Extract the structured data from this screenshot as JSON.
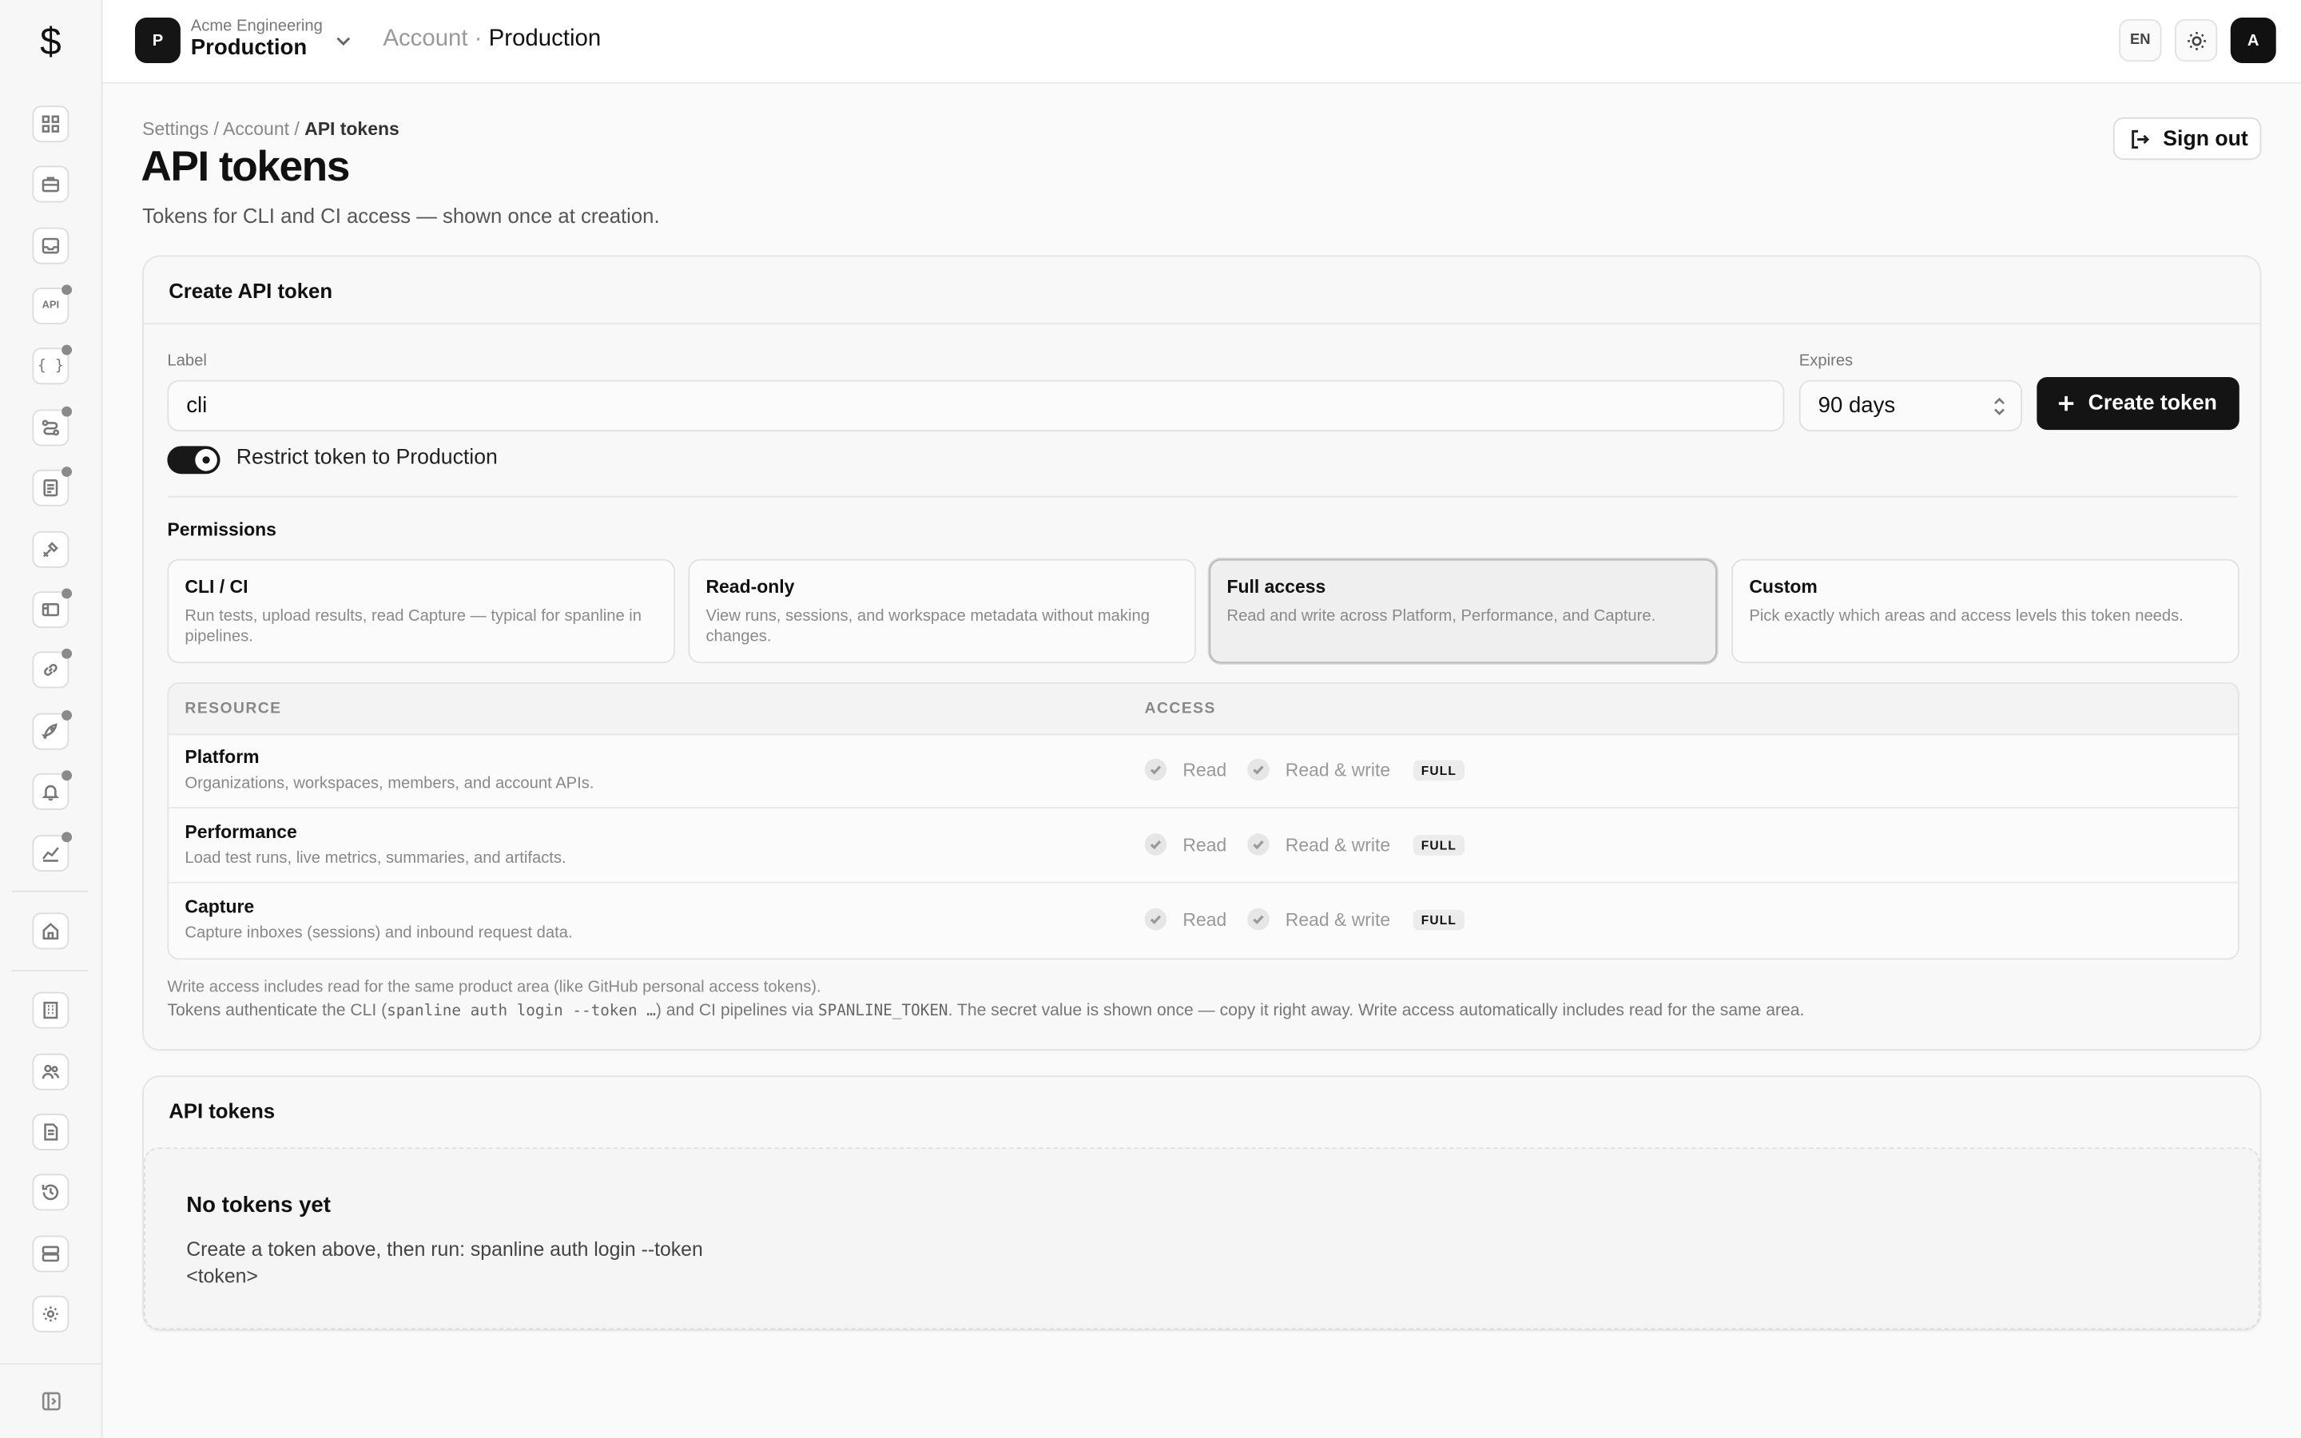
{
  "app": {
    "logo_glyph": "$"
  },
  "topbar": {
    "org_initial": "P",
    "org_name": "Acme Engineering",
    "org_env": "Production",
    "crumb_parent": "Account",
    "crumb_sep": " · ",
    "crumb_current": "Production",
    "lang": "EN",
    "user_initial": "A"
  },
  "sidebar": {
    "items": [
      {
        "icon": "dashboard-icon",
        "badge": false
      },
      {
        "icon": "briefcase-icon",
        "badge": false
      },
      {
        "icon": "inbox-icon",
        "badge": false
      },
      {
        "icon": "api-icon",
        "badge": true,
        "text": "API"
      },
      {
        "icon": "braces-icon",
        "badge": true,
        "text": "{ }"
      },
      {
        "icon": "workflow-icon",
        "badge": true
      },
      {
        "icon": "report-icon",
        "badge": true
      },
      {
        "icon": "tools-icon",
        "badge": false
      },
      {
        "icon": "ticket-icon",
        "badge": true
      },
      {
        "icon": "link-icon",
        "badge": true
      },
      {
        "icon": "rocket-icon",
        "badge": true
      },
      {
        "icon": "bell-icon",
        "badge": true
      },
      {
        "icon": "chart-icon",
        "badge": true
      },
      {
        "icon": "home-icon",
        "badge": false
      },
      {
        "icon": "building-icon",
        "badge": false
      },
      {
        "icon": "users-icon",
        "badge": false
      },
      {
        "icon": "document-icon",
        "badge": false
      },
      {
        "icon": "history-icon",
        "badge": false
      },
      {
        "icon": "storage-icon",
        "badge": false
      },
      {
        "icon": "settings-icon",
        "badge": false
      }
    ]
  },
  "header": {
    "breadcrumb": {
      "a": "Settings",
      "b": "Account",
      "c": "API tokens",
      "sep": " / "
    },
    "title": "API tokens",
    "subtitle": "Tokens for CLI and CI access — shown once at creation.",
    "sign_out": "Sign out"
  },
  "create": {
    "title": "Create API token",
    "label_label": "Label",
    "label_value": "cli",
    "expires_label": "Expires",
    "expires_value": "90 days",
    "create_button": "Create token",
    "restrict_label": "Restrict token to Production",
    "restrict_on": true,
    "permissions_title": "Permissions",
    "presets": [
      {
        "title": "CLI / CI",
        "desc": "Run tests, upload results, read Capture — typical for spanline in pipelines.",
        "selected": false
      },
      {
        "title": "Read-only",
        "desc": "View runs, sessions, and workspace metadata without making changes.",
        "selected": false
      },
      {
        "title": "Full access",
        "desc": "Read and write across Platform, Performance, and Capture.",
        "selected": true
      },
      {
        "title": "Custom",
        "desc": "Pick exactly which areas and access levels this token needs.",
        "selected": false
      }
    ],
    "table": {
      "col_resource": "RESOURCE",
      "col_access": "ACCESS",
      "rows": [
        {
          "name": "Platform",
          "desc": "Organizations, workspaces, members, and account APIs.",
          "read": "Read",
          "write": "Read & write",
          "badge": "FULL"
        },
        {
          "name": "Performance",
          "desc": "Load test runs, live metrics, summaries, and artifacts.",
          "read": "Read",
          "write": "Read & write",
          "badge": "FULL"
        },
        {
          "name": "Capture",
          "desc": "Capture inboxes (sessions) and inbound request data.",
          "read": "Read",
          "write": "Read & write",
          "badge": "FULL"
        }
      ]
    },
    "note1": "Write access includes read for the same product area (like GitHub personal access tokens).",
    "note2_a": "Tokens authenticate the CLI (",
    "note2_code1": "spanline auth login --token …",
    "note2_b": ") and CI pipelines via ",
    "note2_code2": "SPANLINE_TOKEN",
    "note2_c": ". The secret value is shown once — copy it right away. Write access automatically includes read for the same area."
  },
  "tokens": {
    "title": "API tokens",
    "empty_title": "No tokens yet",
    "empty_desc": "Create a token above, then run: spanline auth login --token <token>"
  }
}
